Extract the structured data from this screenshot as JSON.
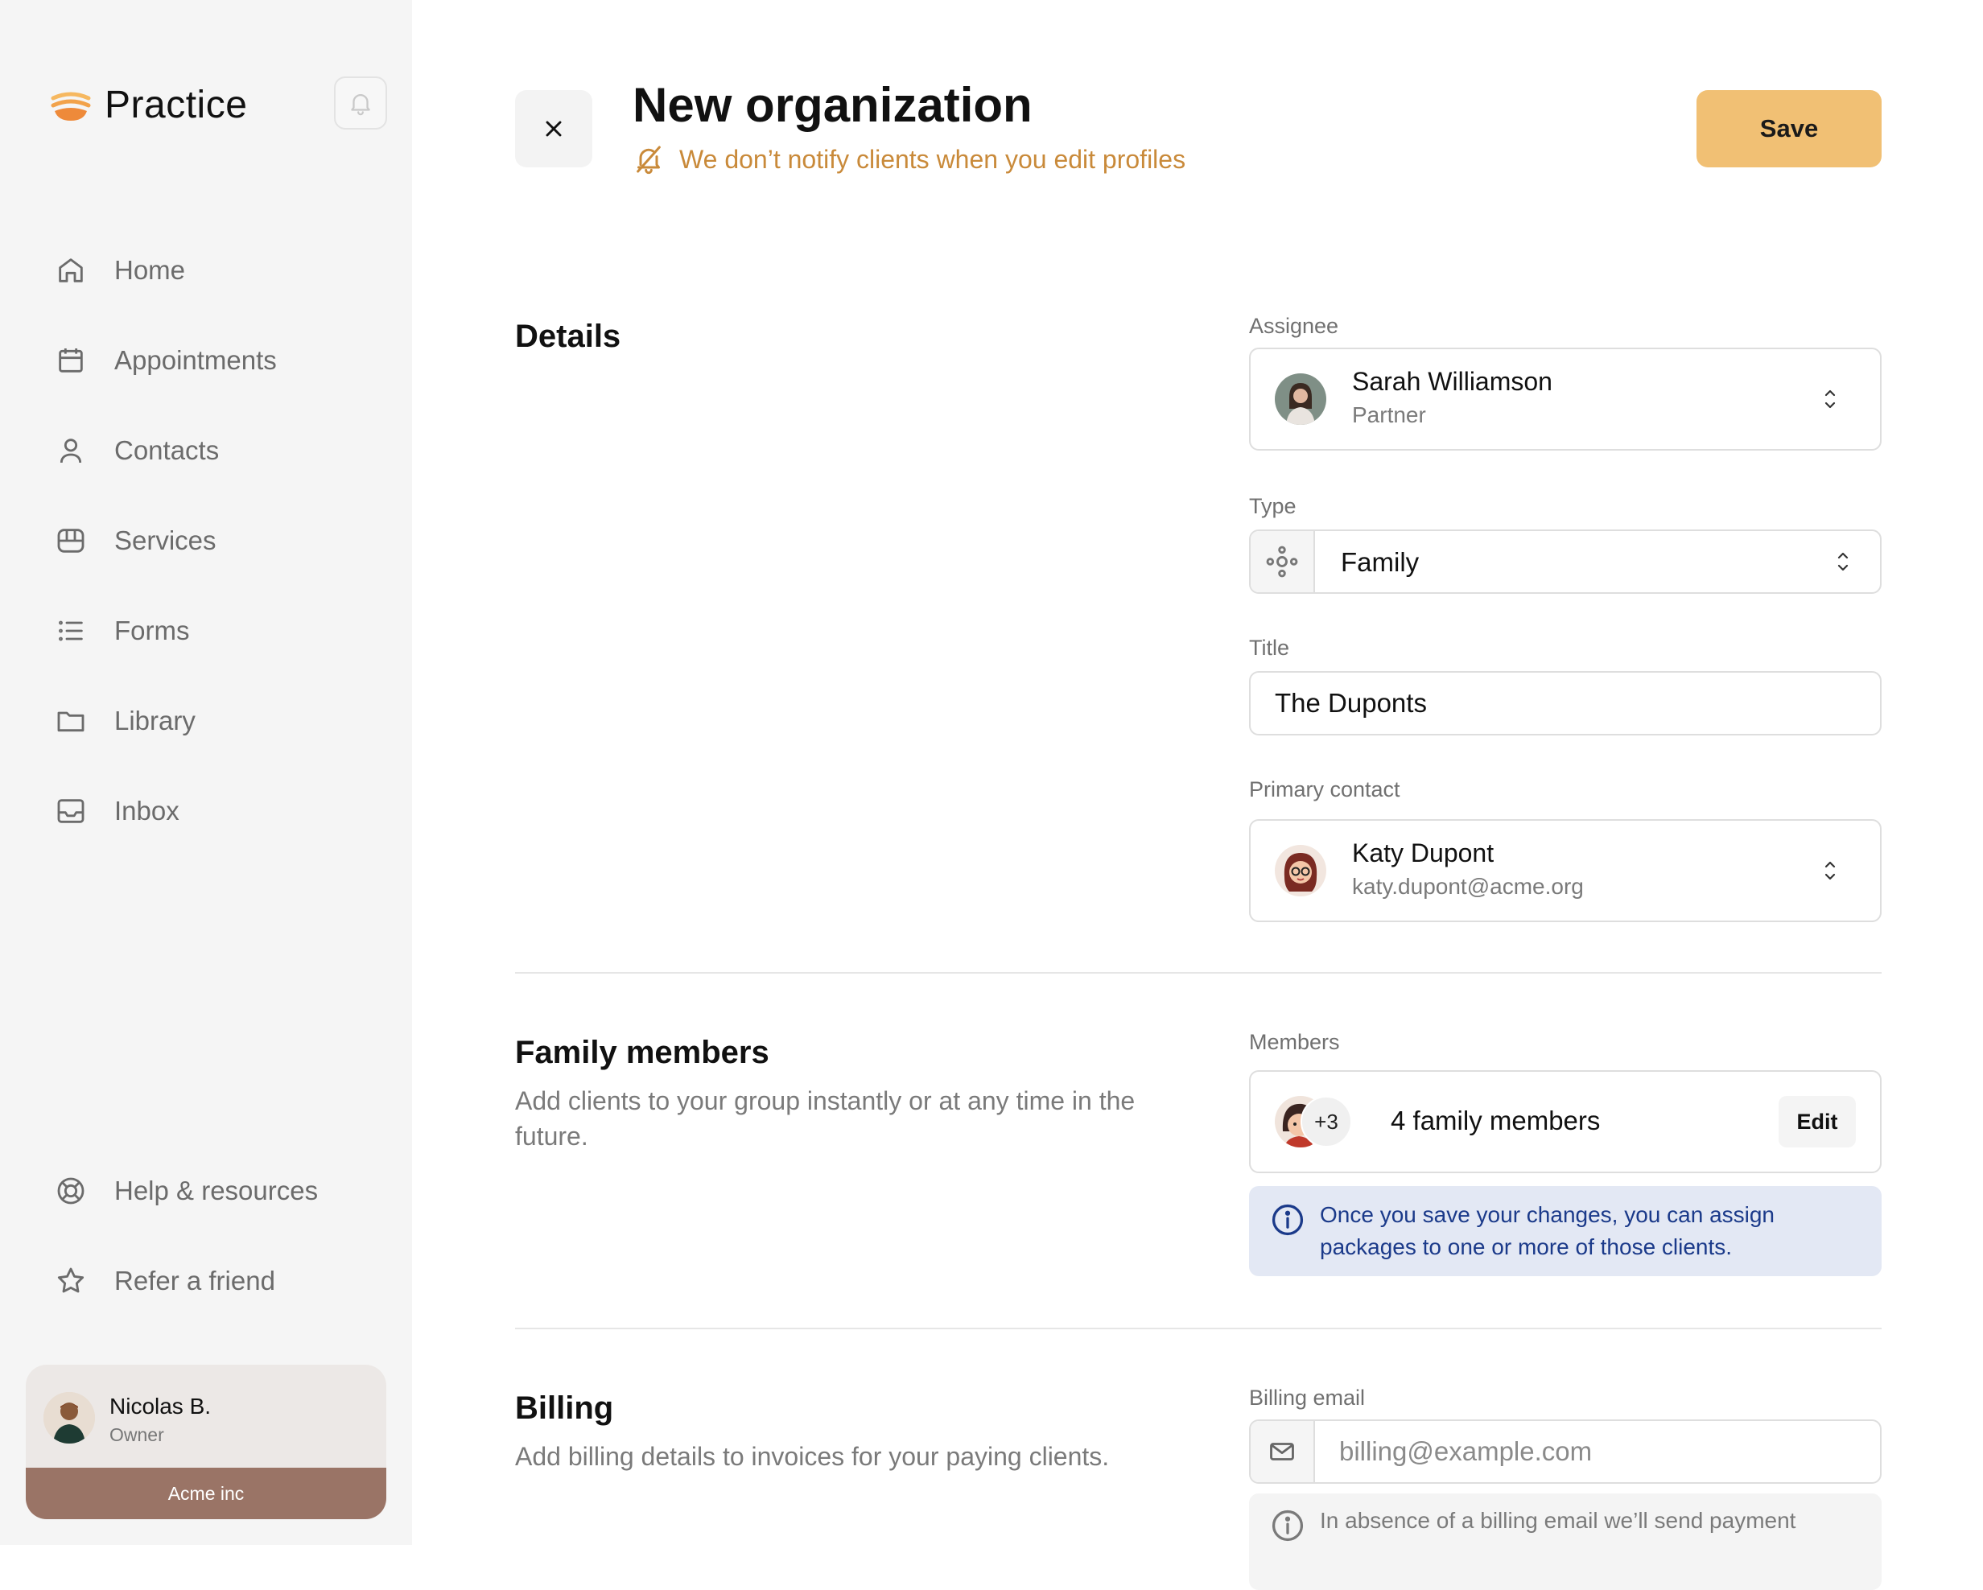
{
  "sidebar": {
    "brand": "Practice",
    "nav": [
      {
        "label": "Home",
        "icon": "home-icon"
      },
      {
        "label": "Appointments",
        "icon": "calendar-icon"
      },
      {
        "label": "Contacts",
        "icon": "user-icon"
      },
      {
        "label": "Services",
        "icon": "services-icon"
      },
      {
        "label": "Forms",
        "icon": "list-icon"
      },
      {
        "label": "Library",
        "icon": "folder-icon"
      },
      {
        "label": "Inbox",
        "icon": "inbox-icon"
      }
    ],
    "bottom_nav": [
      {
        "label": "Help & resources",
        "icon": "lifebuoy-icon"
      },
      {
        "label": "Refer a friend",
        "icon": "star-icon"
      }
    ],
    "user": {
      "name": "Nicolas B.",
      "role": "Owner",
      "org": "Acme inc"
    }
  },
  "header": {
    "title": "New organization",
    "notice": "We don’t notify clients when you edit profiles",
    "save_label": "Save"
  },
  "details": {
    "title": "Details",
    "assignee_label": "Assignee",
    "assignee_name": "Sarah Williamson",
    "assignee_role": "Partner",
    "type_label": "Type",
    "type_value": "Family",
    "title_label": "Title",
    "title_value": "The Duponts",
    "primary_contact_label": "Primary contact",
    "contact_name": "Katy Dupont",
    "contact_email": "katy.dupont@acme.org"
  },
  "family": {
    "title": "Family members",
    "description": "Add clients to your group instantly or at any time in the future.",
    "members_label": "Members",
    "extra_count": "+3",
    "members_text": "4 family members",
    "edit_label": "Edit",
    "info": "Once you save your changes, you can assign packages to one or more of those clients."
  },
  "billing": {
    "title": "Billing",
    "description": "Add billing details to invoices for your paying clients.",
    "email_label": "Billing email",
    "email_placeholder": "billing@example.com",
    "note": "In absence of a billing email we’ll send payment"
  },
  "colors": {
    "accent": "#f1c074",
    "notice": "#c98a3a",
    "org_bar": "#9a7466",
    "info_bg": "#e3e8f4",
    "info_text": "#1b3a8a"
  }
}
